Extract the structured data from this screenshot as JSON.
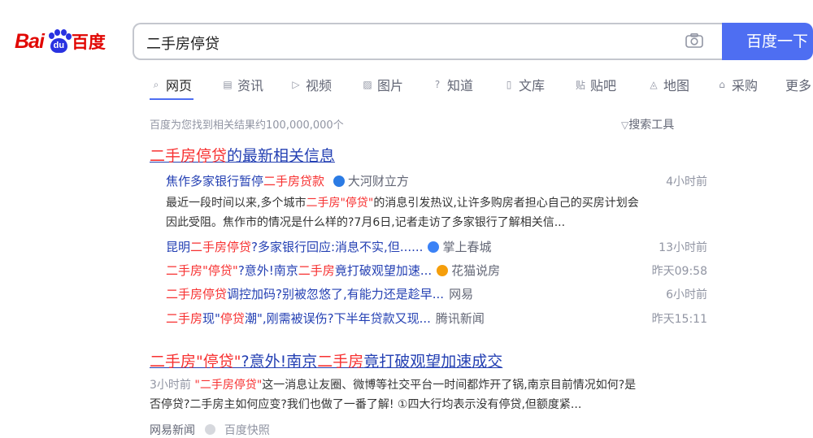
{
  "logo": {
    "bai": "Bai",
    "du_pad": "du",
    "baidu_cn": "百度"
  },
  "search": {
    "query": "二手房停贷",
    "button_label": "百度一下"
  },
  "tabs": [
    {
      "icon": "search-icon",
      "glyph": "⌕",
      "label": "网页",
      "active": true
    },
    {
      "icon": "news-icon",
      "glyph": "▤",
      "label": "资讯"
    },
    {
      "icon": "video-icon",
      "glyph": "▷",
      "label": "视频"
    },
    {
      "icon": "image-icon",
      "glyph": "▨",
      "label": "图片"
    },
    {
      "icon": "question-icon",
      "glyph": "?",
      "label": "知道"
    },
    {
      "icon": "doc-icon",
      "glyph": "▯",
      "label": "文库"
    },
    {
      "icon": "tieba-icon",
      "glyph": "贴",
      "label": "贴吧"
    },
    {
      "icon": "map-icon",
      "glyph": "◬",
      "label": "地图"
    },
    {
      "icon": "shop-icon",
      "glyph": "⌂",
      "label": "采购"
    },
    {
      "icon": "",
      "glyph": "",
      "label": "更多"
    }
  ],
  "result_count": "百度为您找到相关结果约100,000,000个",
  "search_tools": "搜索工具",
  "news_block": {
    "title_em": "二手房停贷",
    "title_rest": "的最新相关信息",
    "lead": {
      "title_pre": "焦作多家银行暂停",
      "title_em": "二手房贷款",
      "source": "大河财立方",
      "time": "4小时前",
      "snippet_1_pre": "最近一段时间以来,多个城市",
      "snippet_1_em": "二手房\"停贷\"",
      "snippet_1_post": "的消息引发热议,让许多购房者担心自己的买房计划会",
      "snippet_2": "因此受阻。焦作市的情况是什么样的?7月6日,记者走访了多家银行了解相关信..."
    },
    "items": [
      {
        "pre": "昆明",
        "em": "二手房停贷",
        "post": "?多家银行回应:消息不实,但......",
        "source": "掌上春城",
        "time": "13小时前",
        "icon_color": "#3b82f6"
      },
      {
        "pre": "",
        "em": "二手房\"停贷\"",
        "post": "?意外!南京",
        "em2": "二手房",
        "post2": "竟打破观望加速...",
        "source": "花猫说房",
        "time": "昨天09:58",
        "icon_color": "#f59e0b"
      },
      {
        "pre": "",
        "em": "二手房停贷",
        "post": "调控加码?别被忽悠了,有能力还是趁早...",
        "source": "网易",
        "time": "6小时前",
        "icon_color": ""
      },
      {
        "pre": "",
        "em": "二手房",
        "post": "现\"",
        "em2": "停贷",
        "post2": "潮\",刚需被误伤?下半年贷款又现...",
        "source": "腾讯新闻",
        "time": "昨天15:11",
        "icon_color": ""
      }
    ]
  },
  "result2": {
    "title_em1": "二手房",
    "title_mid": "\"停贷\"",
    "title_q": "?意外!南京",
    "title_em2": "二手房",
    "title_rest": "竟打破观望加速成交",
    "time": "3小时前",
    "snippet_em": "\"二手房停贷\"",
    "snippet_1": "这一消息让友圈、微博等社交平台一时间都炸开了锅,南京目前情况如何?是",
    "snippet_2": "否停贷?二手房主如何应变?我们也做了一番了解! ①四大行均表示没有停贷,但额度紧...",
    "source": "网易新闻",
    "snapshot": "百度快照"
  }
}
